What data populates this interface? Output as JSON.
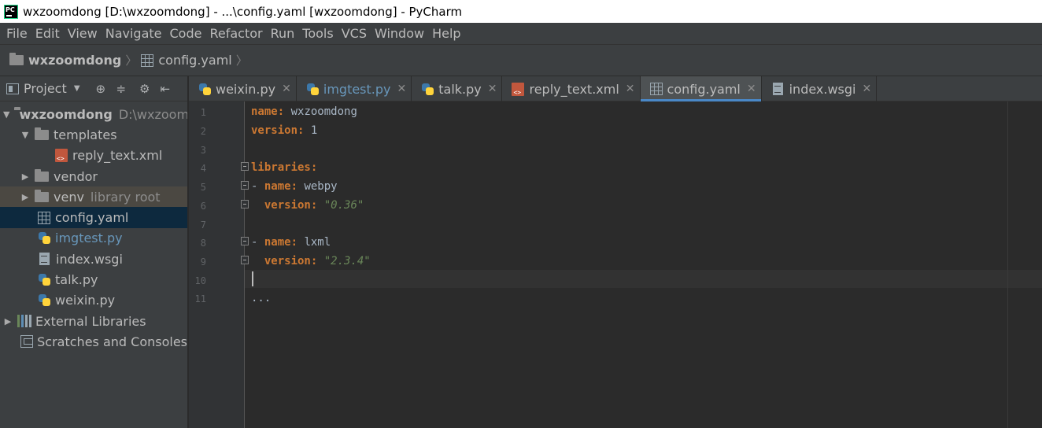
{
  "window": {
    "title": "wxzoomdong [D:\\wxzoomdong] - ...\\config.yaml [wxzoomdong] - PyCharm"
  },
  "menu": [
    "File",
    "Edit",
    "View",
    "Navigate",
    "Code",
    "Refactor",
    "Run",
    "Tools",
    "VCS",
    "Window",
    "Help"
  ],
  "breadcrumb": {
    "project": "wxzoomdong",
    "file": "config.yaml"
  },
  "project_panel": {
    "title": "Project",
    "tree": {
      "root": {
        "name": "wxzoomdong",
        "path": "D:\\wxzoom"
      },
      "templates": "templates",
      "reply_text": "reply_text.xml",
      "vendor": "vendor",
      "venv": {
        "name": "venv",
        "note": "library root"
      },
      "config": "config.yaml",
      "imgtest": "imgtest.py",
      "index": "index.wsgi",
      "talk": "talk.py",
      "weixin": "weixin.py",
      "external": "External Libraries",
      "scratches": "Scratches and Consoles"
    }
  },
  "tabs": [
    {
      "label": "weixin.py",
      "type": "py"
    },
    {
      "label": "imgtest.py",
      "type": "py",
      "modified": true
    },
    {
      "label": "talk.py",
      "type": "py"
    },
    {
      "label": "reply_text.xml",
      "type": "xml"
    },
    {
      "label": "config.yaml",
      "type": "yaml",
      "active": true
    },
    {
      "label": "index.wsgi",
      "type": "doc"
    }
  ],
  "editor": {
    "line_numbers": [
      "1",
      "2",
      "3",
      "4",
      "5",
      "6",
      "7",
      "8",
      "9",
      "10",
      "11"
    ],
    "lines": {
      "l1": {
        "key": "name:",
        "value": " wxzoomdong"
      },
      "l2": {
        "key": "version:",
        "value": " 1"
      },
      "l4": {
        "key": "libraries:"
      },
      "l5": {
        "dash": "- ",
        "key": "name:",
        "value": " webpy"
      },
      "l6": {
        "indent": "  ",
        "key": "version:",
        "string": " \"0.36\""
      },
      "l8": {
        "dash": "- ",
        "key": "name:",
        "value": " lxml"
      },
      "l9": {
        "indent": "  ",
        "key": "version:",
        "string": " \"2.3.4\""
      },
      "l11": "..."
    }
  },
  "colors": {
    "yaml_key": "#cc7832",
    "yaml_string": "#6a8759",
    "active_tab_underline": "#4a88c7",
    "selection": "#0d293e"
  }
}
